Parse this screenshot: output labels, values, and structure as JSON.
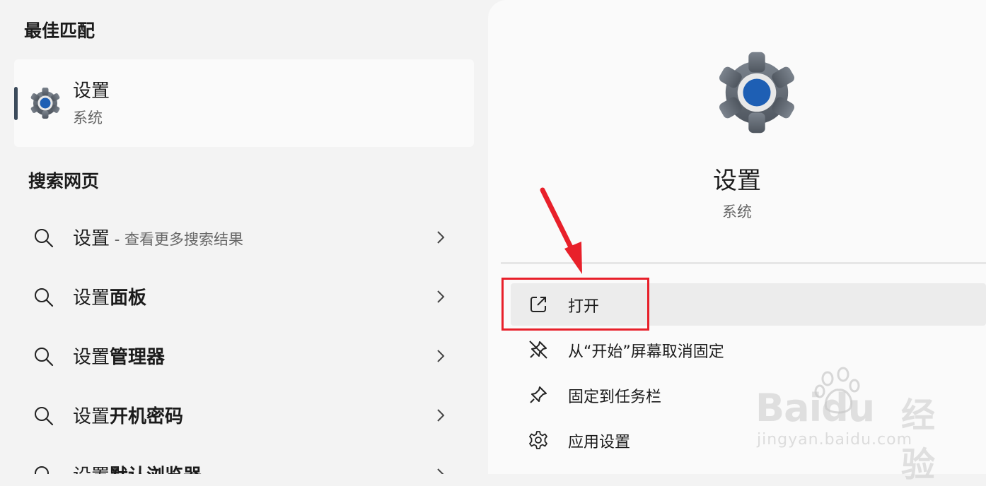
{
  "left": {
    "best_match_title": "最佳匹配",
    "best_match": {
      "title": "设置",
      "subtitle": "系统",
      "icon": "settings-gear-icon"
    },
    "web_title": "搜索网页",
    "web_results": [
      {
        "prefix": "设置",
        "bold": "",
        "hint": " - 查看更多搜索结果"
      },
      {
        "prefix": "设置",
        "bold": "面板",
        "hint": ""
      },
      {
        "prefix": "设置",
        "bold": "管理器",
        "hint": ""
      },
      {
        "prefix": "设置",
        "bold": "开机密码",
        "hint": ""
      },
      {
        "prefix": "设置",
        "bold": "默认浏览器",
        "hint": ""
      }
    ]
  },
  "right": {
    "title": "设置",
    "subtitle": "系统",
    "actions": [
      {
        "label": "打开",
        "icon": "open-external-icon"
      },
      {
        "label": "从“开始”屏幕取消固定",
        "icon": "unpin-icon"
      },
      {
        "label": "固定到任务栏",
        "icon": "pin-icon"
      },
      {
        "label": "应用设置",
        "icon": "gear-icon"
      }
    ]
  },
  "watermark": {
    "brand": "Baidu",
    "product": "经验",
    "url": "jingyan.baidu.com"
  },
  "colors": {
    "accent_red": "#e8202a",
    "gear_gray": "#5f6670",
    "gear_blue": "#1e5fb4"
  }
}
